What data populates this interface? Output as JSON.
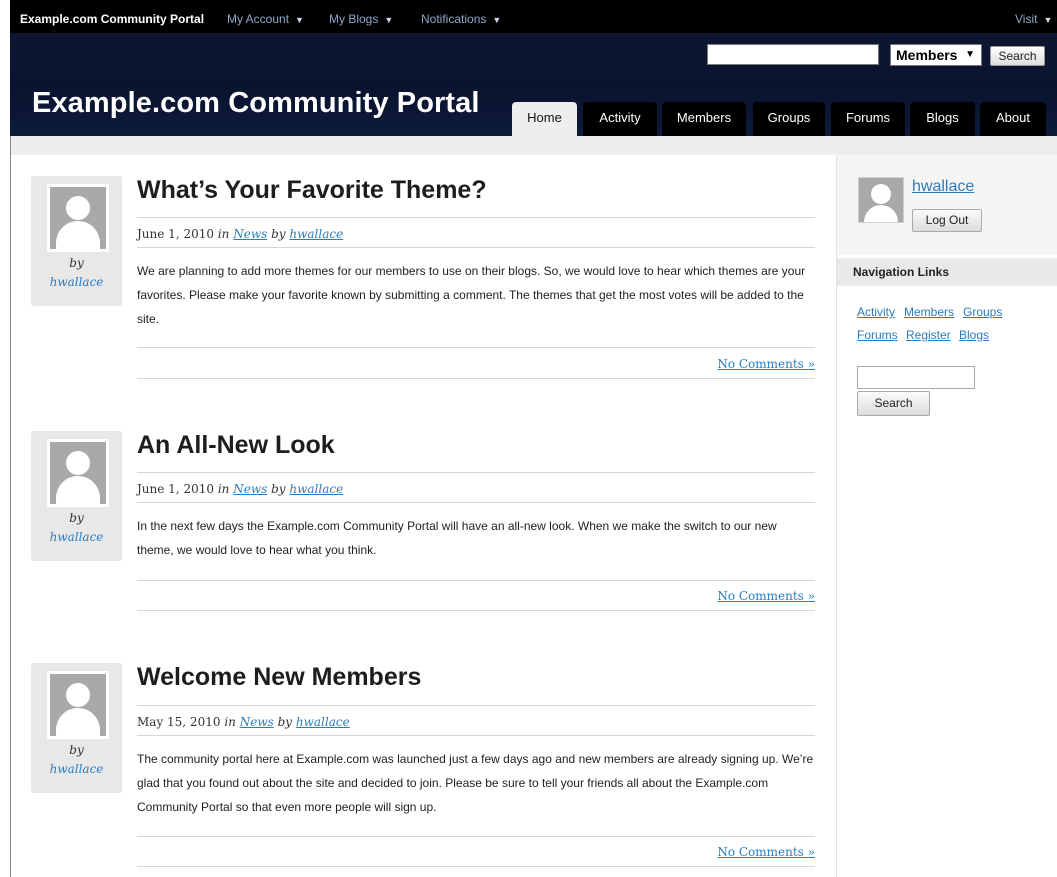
{
  "adminbar": {
    "site_name": "Example.com Community Portal",
    "menu": [
      {
        "label": "My Account"
      },
      {
        "label": "My Blogs"
      },
      {
        "label": "Notifications"
      }
    ],
    "visit_label": "Visit"
  },
  "header": {
    "site_title": "Example.com Community Portal",
    "search_value": "",
    "search_scope": "Members",
    "search_button": "Search"
  },
  "nav": {
    "tabs": [
      {
        "label": "Home",
        "active": true
      },
      {
        "label": "Activity"
      },
      {
        "label": "Members"
      },
      {
        "label": "Groups"
      },
      {
        "label": "Forums"
      },
      {
        "label": "Blogs"
      },
      {
        "label": "About"
      }
    ]
  },
  "posts": [
    {
      "title": "What’s Your Favorite Theme?",
      "date": "June 1, 2010",
      "in_word": "in",
      "category": "News",
      "by_word": "by",
      "author": "hwallace",
      "body": "We are planning to add more themes for our members to use on their blogs. So, we would love to hear which themes are your favorites. Please make your favorite known by submitting a comment. The themes that get the most votes will be added to the site.",
      "comments": "No Comments »"
    },
    {
      "title": "An All-New Look",
      "date": "June 1, 2010",
      "in_word": "in",
      "category": "News",
      "by_word": "by",
      "author": "hwallace",
      "body": "In the next few days the Example.com Community Portal will have an all-new look. When we make the switch to our new theme, we would love to hear what you think.",
      "comments": "No Comments »"
    },
    {
      "title": "Welcome New Members",
      "date": "May 15, 2010",
      "in_word": "in",
      "category": "News",
      "by_word": "by",
      "author": "hwallace",
      "body": "The community portal here at Example.com was launched just a few days ago and new members are already signing up. We’re glad that you found out about the site and decided to join. Please be sure to tell your friends all about the Example.com Community Portal so that even more people will sign up.",
      "comments": "No Comments »"
    }
  ],
  "sidebar": {
    "username": "hwallace",
    "logout_label": "Log Out",
    "nav_heading": "Navigation Links",
    "links": [
      "Activity",
      "Members",
      "Groups",
      "Forums",
      "Register",
      "Blogs"
    ],
    "search_value": "",
    "search_button": "Search"
  }
}
